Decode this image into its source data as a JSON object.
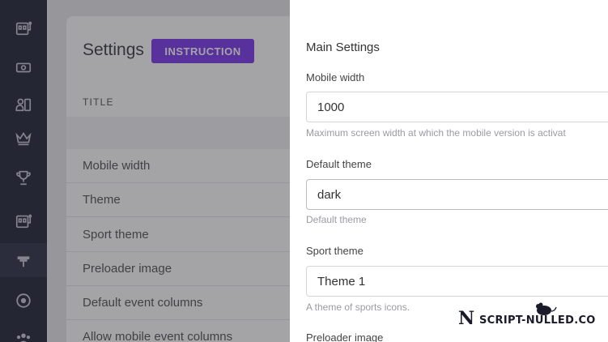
{
  "rail": {
    "icons": [
      "slot-machine-icon",
      "money-icon",
      "users-icon",
      "crown-icon",
      "trophy-icon",
      "slot-machine-icon",
      "umbrella-icon",
      "target-icon",
      "group-icon"
    ],
    "active_index": 6
  },
  "background": {
    "title": "Settings",
    "instruction_label": "INSTRUCTION",
    "table_header": "TITLE",
    "rows": [
      "Mobile width",
      "Theme",
      "Sport theme",
      "Preloader image",
      "Default event columns",
      "Allow mobile event columns"
    ]
  },
  "drawer": {
    "section_title": "Main Settings",
    "fields": [
      {
        "label": "Mobile width",
        "value": "1000",
        "help": "Maximum screen width at which the mobile version is activat"
      },
      {
        "label": "Default theme",
        "value": "dark",
        "help": "Default theme"
      },
      {
        "label": "Sport theme",
        "value": "Theme 1",
        "help": "A theme of sports icons."
      },
      {
        "label": "Preloader image"
      }
    ]
  },
  "watermark": {
    "letter": "N",
    "text": "SCRIPT-NULLED.CO"
  },
  "colors": {
    "rail": "#25273a",
    "accent": "#7c3aed",
    "drawer": "#ffffff"
  }
}
